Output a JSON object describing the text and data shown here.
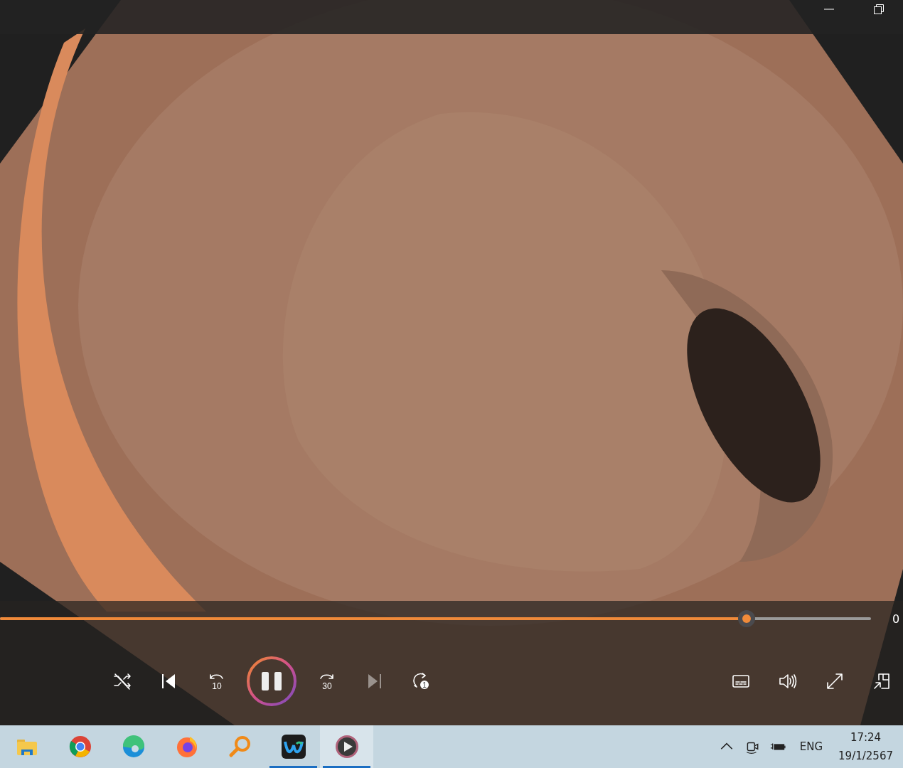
{
  "seek": {
    "level": 0.857,
    "time": "0"
  },
  "transport": [
    {
      "kind": "shuffle",
      "disabled": false
    },
    {
      "kind": "previous",
      "disabled": false
    },
    {
      "kind": "back",
      "label": "10",
      "disabled": false
    },
    {
      "kind": "playpause",
      "playing": true,
      "disabled": false
    },
    {
      "kind": "forward",
      "label": "30",
      "disabled": false
    },
    {
      "kind": "next",
      "disabled": true
    },
    {
      "kind": "repeat",
      "label": "1",
      "disabled": false
    }
  ],
  "tools": [
    {
      "kind": "subtitles"
    },
    {
      "kind": "volume"
    },
    {
      "kind": "fullscreen"
    },
    {
      "kind": "miniplayer"
    }
  ],
  "taskbar": {
    "apps": [
      {
        "kind": "folder",
        "running": false,
        "selected": false
      },
      {
        "kind": "chrome",
        "running": false,
        "selected": false
      },
      {
        "kind": "edge",
        "running": false,
        "selected": false
      },
      {
        "kind": "firefox",
        "running": false,
        "selected": false
      },
      {
        "kind": "search",
        "running": false,
        "selected": false
      },
      {
        "kind": "webex",
        "running": true,
        "selected": false
      },
      {
        "kind": "player",
        "running": true,
        "selected": true
      }
    ],
    "language": "ENG",
    "time": "17:24",
    "date": "19/1/2567"
  }
}
